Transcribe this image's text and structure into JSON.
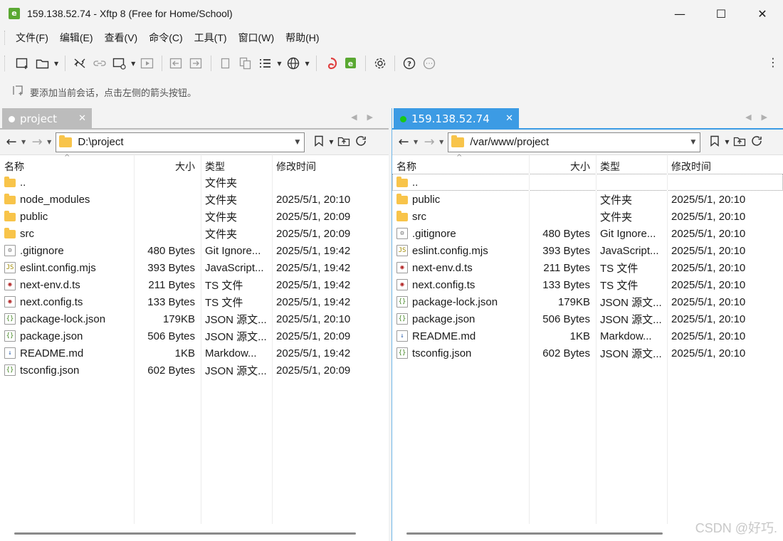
{
  "window": {
    "title": "159.138.52.74 - Xftp 8 (Free for Home/School)",
    "minimize": "—",
    "maximize": "☐",
    "close": "✕"
  },
  "menu": [
    "文件(F)",
    "编辑(E)",
    "查看(V)",
    "命令(C)",
    "工具(T)",
    "窗口(W)",
    "帮助(H)"
  ],
  "session_hint": "要添加当前会话，点击左侧的箭头按钮。",
  "colors": {
    "accent": "#3c9be4",
    "inactive_tab": "#bcbcbc",
    "folder": "#f8c44a",
    "connected_dot": "#19c819"
  },
  "left_pane": {
    "tab_label": "project",
    "path": "D:\\project",
    "headers": [
      "名称",
      "大小",
      "类型",
      "修改时间"
    ],
    "rows": [
      {
        "icon": "folder",
        "name": "..",
        "size": "",
        "type": "文件夹",
        "modified": ""
      },
      {
        "icon": "folder",
        "name": "node_modules",
        "size": "",
        "type": "文件夹",
        "modified": "2025/5/1, 20:10"
      },
      {
        "icon": "folder",
        "name": "public",
        "size": "",
        "type": "文件夹",
        "modified": "2025/5/1, 20:09"
      },
      {
        "icon": "folder",
        "name": "src",
        "size": "",
        "type": "文件夹",
        "modified": "2025/5/1, 20:09"
      },
      {
        "icon": "gear",
        "name": ".gitignore",
        "size": "480 Bytes",
        "type": "Git Ignore...",
        "modified": "2025/5/1, 19:42"
      },
      {
        "icon": "js",
        "name": "eslint.config.mjs",
        "size": "393 Bytes",
        "type": "JavaScript...",
        "modified": "2025/5/1, 19:42"
      },
      {
        "icon": "ts",
        "name": "next-env.d.ts",
        "size": "211 Bytes",
        "type": "TS 文件",
        "modified": "2025/5/1, 19:42"
      },
      {
        "icon": "ts",
        "name": "next.config.ts",
        "size": "133 Bytes",
        "type": "TS 文件",
        "modified": "2025/5/1, 19:42"
      },
      {
        "icon": "json",
        "name": "package-lock.json",
        "size": "179KB",
        "type": "JSON 源文...",
        "modified": "2025/5/1, 20:10"
      },
      {
        "icon": "json",
        "name": "package.json",
        "size": "506 Bytes",
        "type": "JSON 源文...",
        "modified": "2025/5/1, 20:09"
      },
      {
        "icon": "md",
        "name": "README.md",
        "size": "1KB",
        "type": "Markdow...",
        "modified": "2025/5/1, 19:42"
      },
      {
        "icon": "json",
        "name": "tsconfig.json",
        "size": "602 Bytes",
        "type": "JSON 源文...",
        "modified": "2025/5/1, 20:09"
      }
    ]
  },
  "right_pane": {
    "tab_label": "159.138.52.74",
    "path": "/var/www/project",
    "headers": [
      "名称",
      "大小",
      "类型",
      "修改时间"
    ],
    "rows": [
      {
        "icon": "folder",
        "name": "..",
        "size": "",
        "type": "",
        "modified": ""
      },
      {
        "icon": "folder",
        "name": "public",
        "size": "",
        "type": "文件夹",
        "modified": "2025/5/1, 20:10"
      },
      {
        "icon": "folder",
        "name": "src",
        "size": "",
        "type": "文件夹",
        "modified": "2025/5/1, 20:10"
      },
      {
        "icon": "gear",
        "name": ".gitignore",
        "size": "480 Bytes",
        "type": "Git Ignore...",
        "modified": "2025/5/1, 20:10"
      },
      {
        "icon": "js",
        "name": "eslint.config.mjs",
        "size": "393 Bytes",
        "type": "JavaScript...",
        "modified": "2025/5/1, 20:10"
      },
      {
        "icon": "ts",
        "name": "next-env.d.ts",
        "size": "211 Bytes",
        "type": "TS 文件",
        "modified": "2025/5/1, 20:10"
      },
      {
        "icon": "ts",
        "name": "next.config.ts",
        "size": "133 Bytes",
        "type": "TS 文件",
        "modified": "2025/5/1, 20:10"
      },
      {
        "icon": "json",
        "name": "package-lock.json",
        "size": "179KB",
        "type": "JSON 源文...",
        "modified": "2025/5/1, 20:10"
      },
      {
        "icon": "json",
        "name": "package.json",
        "size": "506 Bytes",
        "type": "JSON 源文...",
        "modified": "2025/5/1, 20:10"
      },
      {
        "icon": "md",
        "name": "README.md",
        "size": "1KB",
        "type": "Markdow...",
        "modified": "2025/5/1, 20:10"
      },
      {
        "icon": "json",
        "name": "tsconfig.json",
        "size": "602 Bytes",
        "type": "JSON 源文...",
        "modified": "2025/5/1, 20:10"
      }
    ]
  },
  "watermark": "CSDN @好巧."
}
